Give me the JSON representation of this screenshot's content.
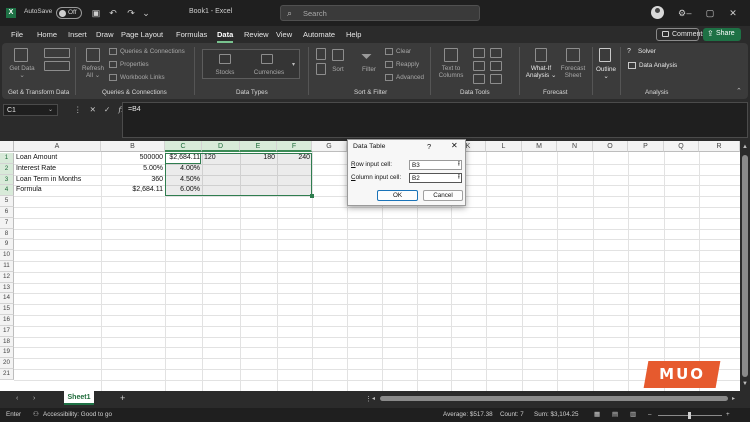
{
  "titlebar": {
    "autosave_label": "AutoSave",
    "autosave_state": "Off",
    "doc_title": "Book1 - Excel",
    "search_placeholder": "Search",
    "icons": [
      "excel-logo-icon",
      "save-icon",
      "undo-icon",
      "redo-icon",
      "customize-qat-icon",
      "search-icon",
      "avatar-icon",
      "settings-icon",
      "minimize-icon",
      "maximize-icon",
      "close-icon"
    ]
  },
  "menu": {
    "tabs": [
      "File",
      "Home",
      "Insert",
      "Draw",
      "Page Layout",
      "Formulas",
      "Data",
      "Review",
      "View",
      "Automate",
      "Help"
    ],
    "active_tab": "Data",
    "comments_label": "Comments",
    "share_label": "Share"
  },
  "ribbon": {
    "get_data": "Get Data",
    "refresh_all": "Refresh All",
    "queries_connections": "Queries & Connections",
    "properties": "Properties",
    "workbook_links": "Workbook Links",
    "stocks": "Stocks",
    "currencies": "Currencies",
    "sort": "Sort",
    "filter": "Filter",
    "clear": "Clear",
    "reapply": "Reapply",
    "advanced": "Advanced",
    "text_to_columns": "Text to Columns",
    "what_if_analysis": "What-If Analysis",
    "forecast_sheet": "Forecast Sheet",
    "outline": "Outline",
    "solver": "Solver",
    "data_analysis": "Data Analysis",
    "groups": {
      "get_transform": "Get & Transform Data",
      "queries": "Queries & Connections",
      "data_types": "Data Types",
      "sort_filter": "Sort & Filter",
      "data_tools": "Data Tools",
      "forecast": "Forecast",
      "analysis": "Analysis"
    }
  },
  "formula_bar": {
    "name_box": "C1",
    "fx_label": "fx",
    "formula": "=B4"
  },
  "grid": {
    "columns": [
      "A",
      "B",
      "C",
      "D",
      "E",
      "F",
      "G",
      "H",
      "I",
      "J",
      "K",
      "L",
      "M",
      "N",
      "O",
      "P",
      "Q",
      "R"
    ],
    "rows": [
      "1",
      "2",
      "3",
      "4",
      "5",
      "6",
      "7",
      "8",
      "9",
      "10",
      "11",
      "12",
      "13",
      "14",
      "15",
      "16",
      "17",
      "18",
      "19",
      "20",
      "21"
    ],
    "cells": {
      "A1": "Loan Amount",
      "A2": "Interest Rate",
      "A3": "Loan Term in Months",
      "A4": "Formula",
      "B1": "500000",
      "B2": "5.00%",
      "B3": "360",
      "B4": "$2,684.11",
      "C1": "$2,684.11",
      "C2": "4.00%",
      "C3": "4.50%",
      "C4": "6.00%",
      "D1": "120",
      "E1": "180",
      "F1": "240"
    }
  },
  "dialog": {
    "title": "Data Table",
    "help": "?",
    "close": "✕",
    "row_label_key": "R",
    "row_label_rest": "ow input cell:",
    "row_value": "B3",
    "col_label_key": "C",
    "col_label_rest": "olumn input cell:",
    "col_value": "B2",
    "ok": "OK",
    "cancel": "Cancel"
  },
  "sheets": {
    "tabs": [
      "Sheet1"
    ],
    "active": "Sheet1"
  },
  "watermark": "MUO",
  "status": {
    "mode": "Enter",
    "accessibility": "Accessibility: Good to go",
    "average": "Average: $517.38",
    "count": "Count: 7",
    "sum": "Sum: $3,104.25"
  }
}
